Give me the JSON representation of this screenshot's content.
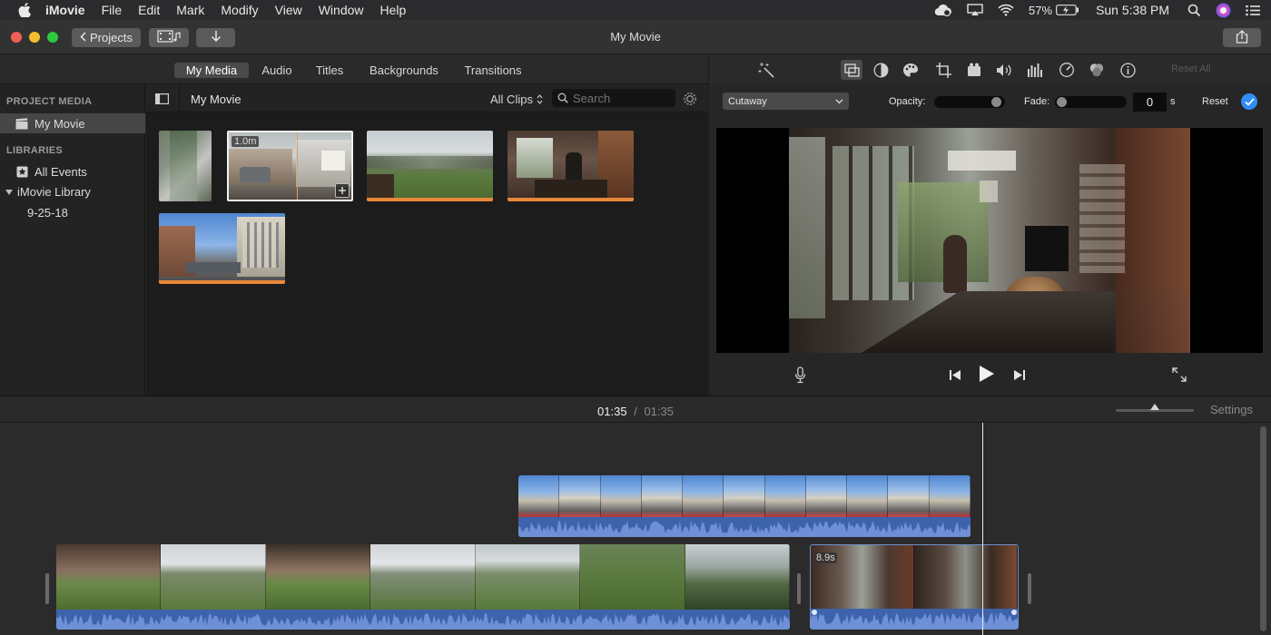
{
  "menubar": {
    "app_name": "iMovie",
    "items": [
      "File",
      "Edit",
      "Mark",
      "Modify",
      "View",
      "Window",
      "Help"
    ],
    "battery": "57%",
    "clock": "Sun 5:38 PM"
  },
  "window": {
    "title": "My Movie",
    "projects_label": "Projects"
  },
  "browser_tabs": [
    "My Media",
    "Audio",
    "Titles",
    "Backgrounds",
    "Transitions"
  ],
  "sidebar": {
    "project_media_heading": "PROJECT MEDIA",
    "project_item": "My Movie",
    "libraries_heading": "LIBRARIES",
    "all_events": "All Events",
    "library": "iMovie Library",
    "event": "9-25-18"
  },
  "media": {
    "title": "My Movie",
    "filter": "All Clips",
    "search_placeholder": "Search",
    "selected_clip_duration": "1.0m"
  },
  "adjustments": {
    "reset_all": "Reset All",
    "overlay_mode": "Cutaway",
    "opacity_label": "Opacity:",
    "fade_label": "Fade:",
    "fade_value": "0",
    "fade_unit": "s",
    "reset_label": "Reset",
    "opacity_fraction": 0.95,
    "fade_fraction": 0.02
  },
  "timeline": {
    "current_time": "01:35",
    "separator": "/",
    "total_time": "01:35",
    "settings_label": "Settings",
    "clip_duration_badge": "8.9s",
    "zoom_fraction": 0.5
  },
  "colors": {
    "accent": "#2f8ef5",
    "clip_progress": "#e8883a",
    "audio_wave": "#3d63ad"
  }
}
